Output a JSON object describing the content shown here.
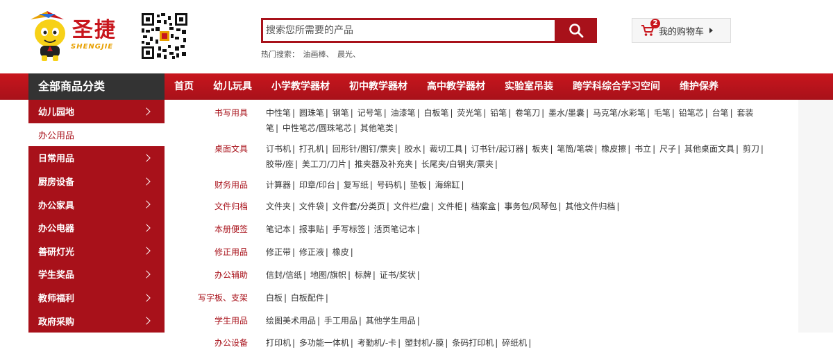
{
  "brand": {
    "name": "圣捷",
    "sub": "SHENGJIE"
  },
  "search": {
    "placeholder": "搜索您所需要的产品",
    "hot_label": "热门搜索：",
    "hot_terms": [
      "油画棒、",
      "晨光、"
    ]
  },
  "cart": {
    "label": "我的购物车",
    "count": "2"
  },
  "nav": {
    "all_categories": "全部商品分类",
    "items": [
      "首页",
      "幼儿玩具",
      "小学教学器材",
      "初中教学器材",
      "高中教学器材",
      "实验室吊装",
      "跨学科综合学习空间",
      "维护保养"
    ]
  },
  "sidebar": {
    "items": [
      "幼儿园地",
      "办公用品",
      "日常用品",
      "厨房设备",
      "办公家具",
      "办公电器",
      "善研灯光",
      "学生奖品",
      "教师福利",
      "政府采购"
    ],
    "active_index": 1
  },
  "categories": [
    {
      "title": "书写用具",
      "links": [
        "中性笔",
        "圆珠笔",
        "钢笔",
        "记号笔",
        "油漆笔",
        "白板笔",
        "荧光笔",
        "铅笔",
        "卷笔刀",
        "墨水/墨囊",
        "马克笔/水彩笔",
        "毛笔",
        "铅笔芯",
        "台笔",
        "套装笔",
        "中性笔芯/圆珠笔芯",
        "其他笔类"
      ]
    },
    {
      "title": "桌面文具",
      "links": [
        "订书机",
        "打孔机",
        "回形针/图钉/票夹",
        "胶水",
        "裁切工具",
        "订书针/起订器",
        "板夹",
        "笔筒/笔袋",
        "橡皮擦",
        "书立",
        "尺子",
        "其他桌面文具",
        "剪刀",
        "胶带/座",
        "美工刀/刀片",
        "推夹器及补充夹",
        "长尾夹/白钢夹/票夹"
      ]
    },
    {
      "title": "财务用品",
      "links": [
        "计算器",
        "印章/印台",
        "复写纸",
        "号码机",
        "垫板",
        "海绵缸"
      ]
    },
    {
      "title": "文件归档",
      "links": [
        "文件夹",
        "文件袋",
        "文件套/分类页",
        "文件栏/盘",
        "文件柜",
        "档案盒",
        "事务包/风琴包",
        "其他文件归档"
      ]
    },
    {
      "title": "本册便签",
      "links": [
        "笔记本",
        "报事贴",
        "手写标签",
        "活页笔记本"
      ]
    },
    {
      "title": "修正用品",
      "links": [
        "修正带",
        "修正液",
        "橡皮"
      ]
    },
    {
      "title": "办公辅助",
      "links": [
        "信封/信纸",
        "地图/旗帜",
        "标牌",
        "证书/奖状"
      ]
    },
    {
      "title": "写字板、支架",
      "links": [
        "白板",
        "白板配件"
      ]
    },
    {
      "title": "学生用品",
      "links": [
        "绘图美术用品",
        "手工用品",
        "其他学生用品"
      ]
    },
    {
      "title": "办公设备",
      "links": [
        "打印机",
        "多功能一体机",
        "考勤机/-卡",
        "塑封机/-膜",
        "条码打印机",
        "碎纸机"
      ]
    }
  ],
  "colors": {
    "brand_red": "#a8111a",
    "dark": "#333333"
  }
}
